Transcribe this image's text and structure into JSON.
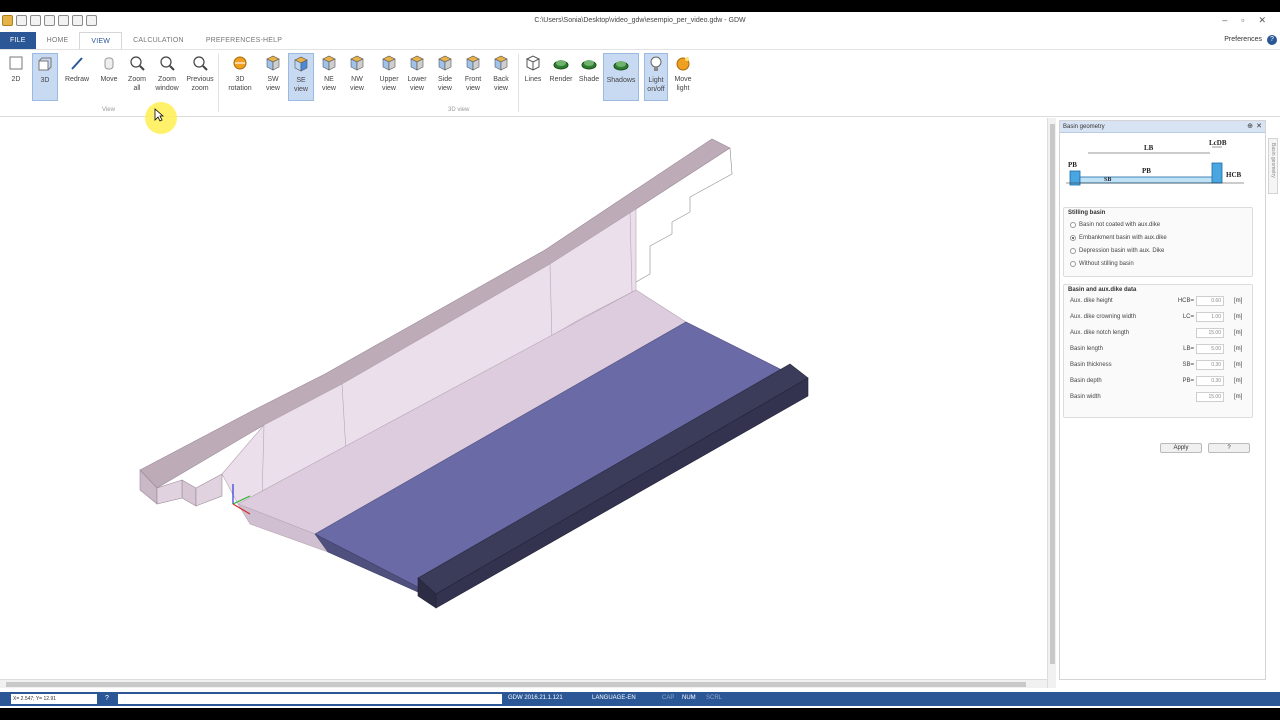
{
  "window": {
    "title": "C:\\Users\\Sonia\\Desktop\\video_gdw\\esempio_per_video.gdw - GDW",
    "controls": [
      "–",
      "▫",
      "✕"
    ]
  },
  "quick_access_icons": [
    "app-icon",
    "save-icon",
    "print-preview-icon",
    "zoom-all-icon",
    "pan-icon",
    "zoom-window-icon",
    "undo-zoom-icon",
    "qat-dropdown-icon"
  ],
  "tabs": [
    {
      "label": "FILE",
      "active": false
    },
    {
      "label": "HOME",
      "active": false
    },
    {
      "label": "VIEW",
      "active": true
    },
    {
      "label": "CALCULATION",
      "active": false
    },
    {
      "label": "PREFERENCES-HELP",
      "active": false
    }
  ],
  "preferences": {
    "label": "Preferences",
    "help": "?"
  },
  "ribbon": {
    "buttons": [
      {
        "label": "2D",
        "icon": "square-icon",
        "selected": false
      },
      {
        "label": "3D",
        "icon": "cube-outline-icon",
        "selected": true
      },
      {
        "label": "Redraw",
        "icon": "pencil-icon",
        "selected": false
      },
      {
        "label": "Move",
        "icon": "hand-icon",
        "selected": false
      },
      {
        "label": "Zoom\nall",
        "icon": "zoom-all-icon",
        "selected": false
      },
      {
        "label": "Zoom\nwindow",
        "icon": "zoom-window-icon",
        "selected": false
      },
      {
        "label": "Previous\nzoom",
        "icon": "previous-zoom-icon",
        "selected": false
      },
      {
        "label": "3D\nrotation",
        "icon": "rotation-icon",
        "selected": false
      },
      {
        "label": "SW\nview",
        "icon": "sw-view-icon",
        "selected": false
      },
      {
        "label": "SE\nview",
        "icon": "se-view-icon",
        "selected": true
      },
      {
        "label": "NE\nview",
        "icon": "ne-view-icon",
        "selected": false
      },
      {
        "label": "NW\nview",
        "icon": "nw-view-icon",
        "selected": false
      },
      {
        "label": "Upper\nview",
        "icon": "upper-view-icon",
        "selected": false
      },
      {
        "label": "Lower\nview",
        "icon": "lower-view-icon",
        "selected": false
      },
      {
        "label": "Side\nview",
        "icon": "side-view-icon",
        "selected": false
      },
      {
        "label": "Front\nview",
        "icon": "front-view-icon",
        "selected": false
      },
      {
        "label": "Back\nview",
        "icon": "back-view-icon",
        "selected": false
      },
      {
        "label": "Lines",
        "icon": "lines-icon",
        "selected": false
      },
      {
        "label": "Render",
        "icon": "render-icon",
        "selected": false
      },
      {
        "label": "Shade",
        "icon": "shade-icon",
        "selected": false
      },
      {
        "label": "Shadows",
        "icon": "shadows-icon",
        "selected": true
      },
      {
        "label": "Light\non/off",
        "icon": "light-bulb-icon",
        "selected": true
      },
      {
        "label": "Move\nlight",
        "icon": "move-light-icon",
        "selected": false
      }
    ],
    "groups": [
      "View",
      "3D view"
    ]
  },
  "panel": {
    "title": "Basin geometry",
    "side_tab": "Basin geometry",
    "diagram_labels": {
      "lcdb": "LcDB",
      "lb": "LB",
      "pb1": "PB",
      "hcb": "HCB",
      "sb": "SB",
      "pb2": "PB"
    },
    "stilling": {
      "title": "Stilling basin",
      "options": [
        {
          "label": "Basin not coated with aux.dike",
          "checked": false
        },
        {
          "label": "Embankment basin with aux.dike",
          "checked": true
        },
        {
          "label": "Depression basin with aux. Dike",
          "checked": false
        },
        {
          "label": "Without stilling basin",
          "checked": false
        }
      ]
    },
    "basin_data": {
      "title": "Basin and aux.dike data",
      "fields": [
        {
          "label": "Aux. dike height",
          "code": "HCB=",
          "value": "0.60",
          "unit": "[m]"
        },
        {
          "label": "Aux. dike crowning width",
          "code": "LC=",
          "value": "1.00",
          "unit": "[m]"
        },
        {
          "label": "Aux. dike notch length",
          "code": "",
          "value": "15.00",
          "unit": "[m]"
        },
        {
          "label": "Basin length",
          "code": "LB=",
          "value": "5.00",
          "unit": "[m]"
        },
        {
          "label": "Basin thickness",
          "code": "SB=",
          "value": "0.30",
          "unit": "[m]"
        },
        {
          "label": "Basin depth",
          "code": "PB=",
          "value": "0.30",
          "unit": "[m]"
        },
        {
          "label": "Basin width",
          "code": "",
          "value": "15.00",
          "unit": "[m]"
        }
      ]
    },
    "apply_label": "Apply",
    "help_label": "?"
  },
  "status": {
    "coords": "X= 2.547; Y= 12.91",
    "help": "?",
    "version": "GDW 2016.21.1.121",
    "language": "LANGUAGE-EN",
    "cap": "CAP",
    "num": "NUM",
    "scrl": "SCRL"
  },
  "colors": {
    "accent": "#2b5797",
    "selected": "#c8daf2",
    "wall_top": "#bcaab8",
    "wall_face": "#e6d6e6",
    "basin_top": "#6a6aa8",
    "dike": "#33334f"
  }
}
